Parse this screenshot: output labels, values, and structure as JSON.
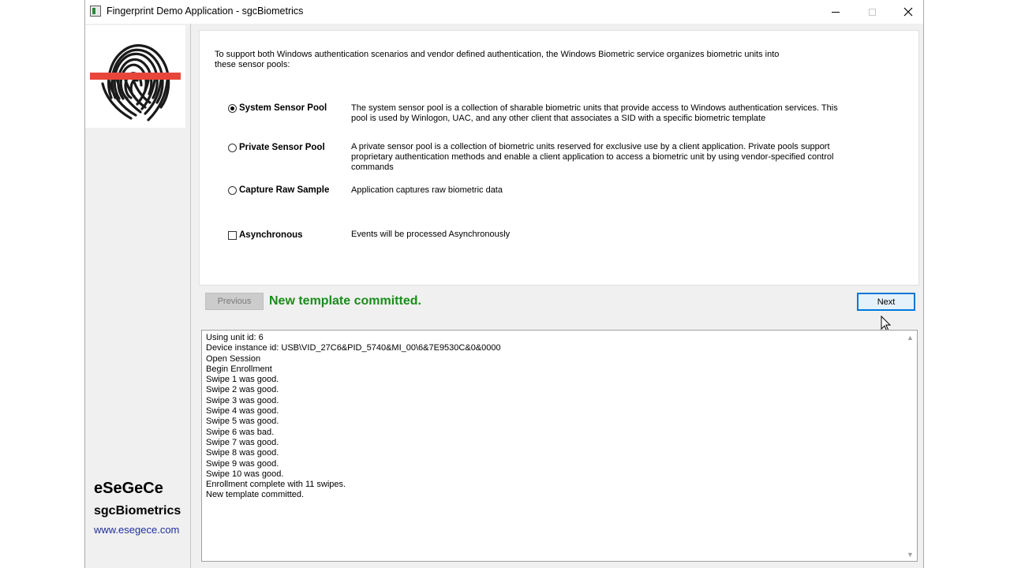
{
  "window": {
    "title": "Fingerprint Demo Application - sgcBiometrics"
  },
  "sidebar": {
    "brand_name": "eSeGeCe",
    "product_name": "sgcBiometrics",
    "website": "www.esegece.com"
  },
  "panel": {
    "intro": "To support both Windows authentication scenarios and vendor defined authentication, the Windows Biometric service organizes biometric units into these sensor pools:",
    "options": [
      {
        "label": "System Sensor Pool",
        "type": "radio",
        "checked": true,
        "description": "The system sensor pool is a collection of sharable biometric units that provide access to Windows authentication services. This pool is used by Winlogon, UAC, and any other client that associates a SID with a specific biometric template"
      },
      {
        "label": "Private Sensor Pool",
        "type": "radio",
        "checked": false,
        "description": "A private sensor pool is a collection of biometric units reserved for exclusive use by a client application. Private pools support proprietary authentication methods and enable a client application to access a biometric unit by using vendor-specified control commands"
      },
      {
        "label": "Capture Raw Sample",
        "type": "radio",
        "checked": false,
        "description": "Application captures raw biometric data"
      },
      {
        "label": "Asynchronous",
        "type": "checkbox",
        "checked": false,
        "description": "Events will be processed Asynchronously"
      }
    ]
  },
  "nav": {
    "previous_label": "Previous",
    "status": "New template committed.",
    "next_label": "Next"
  },
  "log": {
    "lines": [
      "Using unit id: 6",
      "Device instance id: USB\\VID_27C6&PID_5740&MI_00\\6&7E9530C&0&0000",
      "Open Session",
      "Begin Enrollment",
      "Swipe 1 was good.",
      "Swipe 2 was good.",
      "Swipe 3 was good.",
      "Swipe 4 was good.",
      "Swipe 5 was good.",
      "Swipe 6 was bad.",
      "Swipe 7 was good.",
      "Swipe 8 was good.",
      "Swipe 9 was good.",
      "Swipe 10 was good.",
      "Enrollment complete with 11 swipes.",
      "New template committed."
    ]
  },
  "colors": {
    "status_green": "#1a8c1a",
    "accent_blue": "#0078d7",
    "logo_red": "#e8463a",
    "link_blue": "#1f2f9f"
  }
}
